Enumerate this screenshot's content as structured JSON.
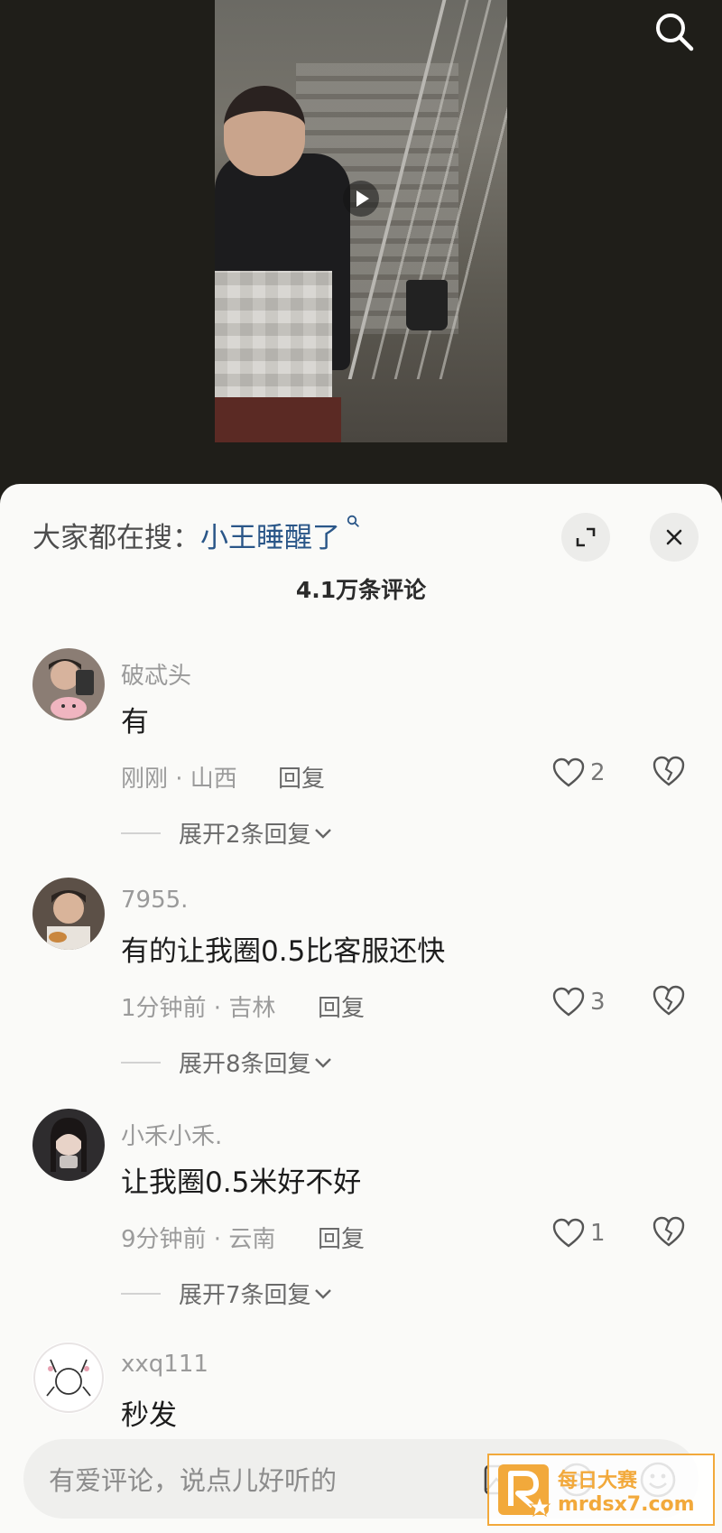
{
  "video": {
    "play_icon": "play-icon",
    "search_icon": "search-icon"
  },
  "sheet": {
    "hot_search_prefix": "大家都在搜：",
    "hot_search_term": "小王睡醒了",
    "comment_count": "4.1万条评论"
  },
  "comments": [
    {
      "username": "破忒头",
      "content": "有",
      "meta": "刚刚 · 山西",
      "reply_label": "回复",
      "likes": "2",
      "expand_label": "展开2条回复"
    },
    {
      "username": "7955.",
      "content": "有的让我圈0.5比客服还快",
      "meta": "1分钟前 · 吉林",
      "reply_label": "回复",
      "likes": "3",
      "expand_label": "展开8条回复"
    },
    {
      "username": "小禾小禾.",
      "content": "让我圈0.5米好不好",
      "meta": "9分钟前 · 云南",
      "reply_label": "回复",
      "likes": "1",
      "expand_label": "展开7条回复"
    },
    {
      "username": "xxq111",
      "content": "秒发"
    }
  ],
  "input": {
    "placeholder": "有爱评论，说点儿好听的"
  },
  "watermark": {
    "title": "每日大赛",
    "url": "mrdsx7.com"
  },
  "colors": {
    "accent_link": "#2a5688",
    "sheet_bg": "#fafaf8",
    "watermark": "#f2a93b"
  }
}
